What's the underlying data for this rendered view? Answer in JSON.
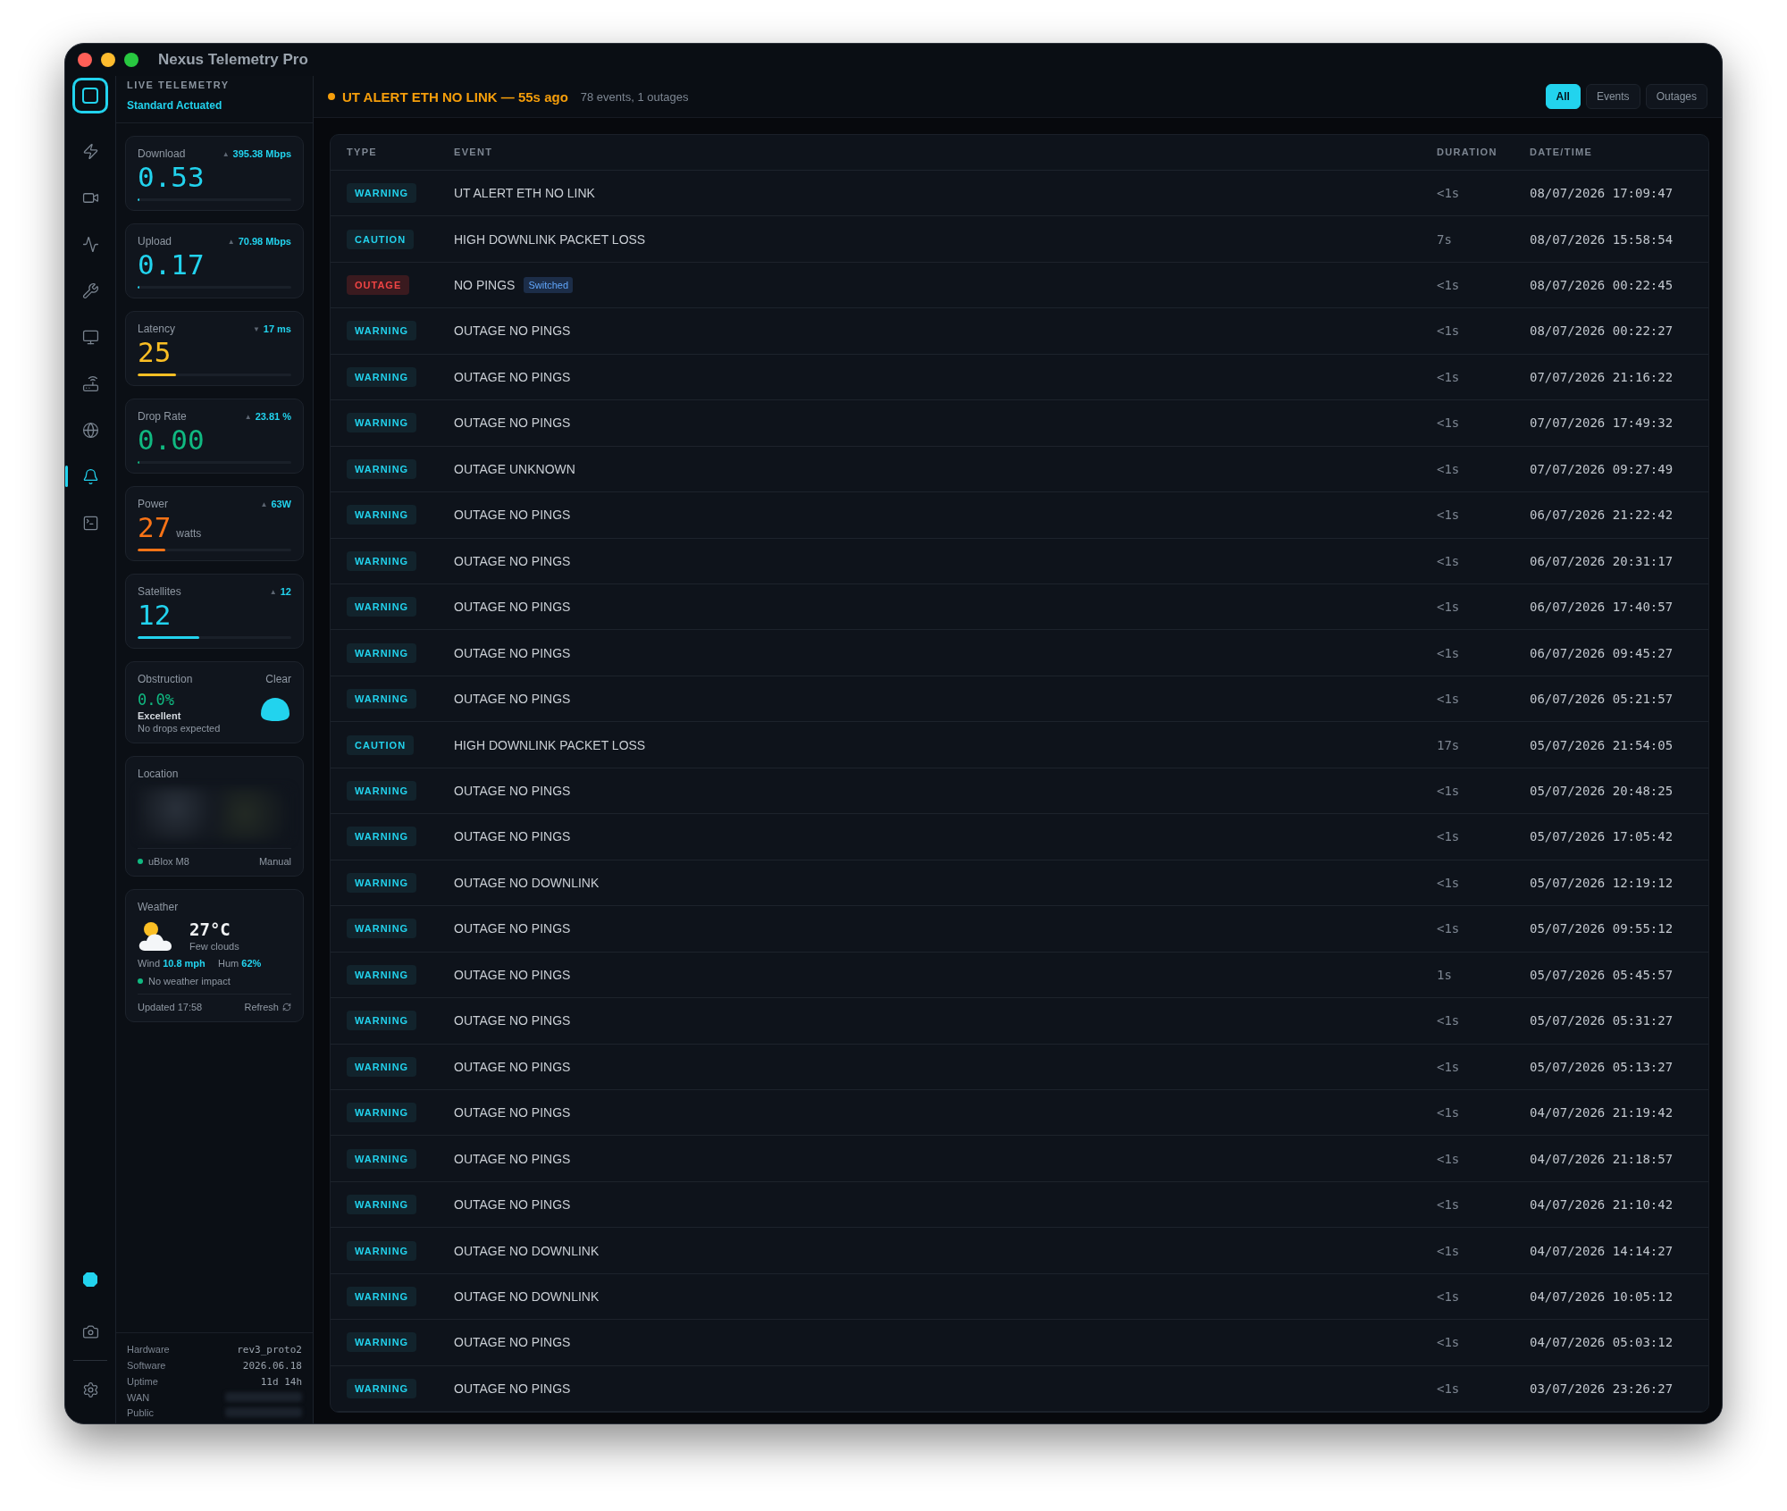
{
  "window": {
    "title": "Nexus Telemetry Pro"
  },
  "rail": {
    "items": [
      {
        "selected": false
      },
      {
        "selected": false
      },
      {
        "selected": false
      },
      {
        "selected": false
      },
      {
        "selected": false
      },
      {
        "selected": false
      },
      {
        "selected": false
      },
      {
        "selected": true
      },
      {
        "selected": false
      }
    ]
  },
  "sidebar": {
    "title": "LIVE TELEMETRY",
    "subtitle": "Standard Actuated",
    "metrics": [
      {
        "label": "Download",
        "trend": "▲",
        "delta": "395.38 Mbps",
        "value": "0.53",
        "color": "#22d3ee",
        "level": 0.01
      },
      {
        "label": "Upload",
        "trend": "▲",
        "delta": "70.98 Mbps",
        "value": "0.17",
        "color": "#22d3ee",
        "level": 0.01
      },
      {
        "label": "Latency",
        "trend": "▼",
        "delta": "17 ms",
        "value": "25",
        "color": "#fbbf24",
        "level": 0.25
      },
      {
        "label": "Drop Rate",
        "trend": "▲",
        "delta": "23.81 %",
        "value": "0.00",
        "color": "#10b981",
        "level": 0
      },
      {
        "label": "Power",
        "trend": "▲",
        "delta": "63W",
        "value": "27",
        "unit": "watts",
        "color": "#f97316",
        "level": 0.18
      },
      {
        "label": "Satellites",
        "trend": "▲",
        "delta": "12",
        "value": "12",
        "color": "#22d3ee",
        "level": 0.4
      }
    ],
    "obstruction": {
      "label": "Obstruction",
      "status": "Clear",
      "value": "0.0%",
      "rating": "Excellent",
      "note": "No drops expected"
    },
    "location": {
      "label": "Location",
      "source": "uBlox M8",
      "mode": "Manual"
    },
    "weather": {
      "label": "Weather",
      "temp": "27°C",
      "condition": "Few clouds",
      "wind_label": "Wind",
      "wind": "10.8 mph",
      "hum_label": "Hum",
      "hum": "62%",
      "impact": "No weather impact",
      "updated": "Updated 17:58",
      "refresh": "Refresh"
    },
    "system": [
      {
        "label": "Hardware",
        "value": "rev3_proto2",
        "redacted": false
      },
      {
        "label": "Software",
        "value": "2026.06.18",
        "redacted": false
      },
      {
        "label": "Uptime",
        "value": "11d 14h",
        "redacted": false
      },
      {
        "label": "WAN",
        "redacted": true
      },
      {
        "label": "Public",
        "redacted": true
      }
    ]
  },
  "header": {
    "alert": "UT ALERT ETH NO LINK — 55s ago",
    "summary": "78 events, 1 outages",
    "filters": [
      {
        "label": "All",
        "selected": true
      },
      {
        "label": "Events",
        "selected": false
      },
      {
        "label": "Outages",
        "selected": false
      }
    ]
  },
  "table": {
    "columns": [
      "TYPE",
      "EVENT",
      "DURATION",
      "DATE/TIME"
    ],
    "rows": [
      {
        "kind": "warning",
        "type": "WARNING",
        "event": "UT ALERT ETH NO LINK",
        "duration": "<1s",
        "datetime": "08/07/2026 17:09:47"
      },
      {
        "kind": "caution",
        "type": "CAUTION",
        "event": "HIGH DOWNLINK PACKET LOSS",
        "duration": "7s",
        "datetime": "08/07/2026 15:58:54"
      },
      {
        "kind": "outage",
        "type": "OUTAGE",
        "event": "NO PINGS",
        "tag": "Switched",
        "duration": "<1s",
        "datetime": "08/07/2026 00:22:45"
      },
      {
        "kind": "warning",
        "type": "WARNING",
        "event": "OUTAGE NO PINGS",
        "duration": "<1s",
        "datetime": "08/07/2026 00:22:27"
      },
      {
        "kind": "warning",
        "type": "WARNING",
        "event": "OUTAGE NO PINGS",
        "duration": "<1s",
        "datetime": "07/07/2026 21:16:22"
      },
      {
        "kind": "warning",
        "type": "WARNING",
        "event": "OUTAGE NO PINGS",
        "duration": "<1s",
        "datetime": "07/07/2026 17:49:32"
      },
      {
        "kind": "warning",
        "type": "WARNING",
        "event": "OUTAGE UNKNOWN",
        "duration": "<1s",
        "datetime": "07/07/2026 09:27:49"
      },
      {
        "kind": "warning",
        "type": "WARNING",
        "event": "OUTAGE NO PINGS",
        "duration": "<1s",
        "datetime": "06/07/2026 21:22:42"
      },
      {
        "kind": "warning",
        "type": "WARNING",
        "event": "OUTAGE NO PINGS",
        "duration": "<1s",
        "datetime": "06/07/2026 20:31:17"
      },
      {
        "kind": "warning",
        "type": "WARNING",
        "event": "OUTAGE NO PINGS",
        "duration": "<1s",
        "datetime": "06/07/2026 17:40:57"
      },
      {
        "kind": "warning",
        "type": "WARNING",
        "event": "OUTAGE NO PINGS",
        "duration": "<1s",
        "datetime": "06/07/2026 09:45:27"
      },
      {
        "kind": "warning",
        "type": "WARNING",
        "event": "OUTAGE NO PINGS",
        "duration": "<1s",
        "datetime": "06/07/2026 05:21:57"
      },
      {
        "kind": "caution",
        "type": "CAUTION",
        "event": "HIGH DOWNLINK PACKET LOSS",
        "duration": "17s",
        "datetime": "05/07/2026 21:54:05"
      },
      {
        "kind": "warning",
        "type": "WARNING",
        "event": "OUTAGE NO PINGS",
        "duration": "<1s",
        "datetime": "05/07/2026 20:48:25"
      },
      {
        "kind": "warning",
        "type": "WARNING",
        "event": "OUTAGE NO PINGS",
        "duration": "<1s",
        "datetime": "05/07/2026 17:05:42"
      },
      {
        "kind": "warning",
        "type": "WARNING",
        "event": "OUTAGE NO DOWNLINK",
        "duration": "<1s",
        "datetime": "05/07/2026 12:19:12"
      },
      {
        "kind": "warning",
        "type": "WARNING",
        "event": "OUTAGE NO PINGS",
        "duration": "<1s",
        "datetime": "05/07/2026 09:55:12"
      },
      {
        "kind": "warning",
        "type": "WARNING",
        "event": "OUTAGE NO PINGS",
        "duration": "1s",
        "datetime": "05/07/2026 05:45:57"
      },
      {
        "kind": "warning",
        "type": "WARNING",
        "event": "OUTAGE NO PINGS",
        "duration": "<1s",
        "datetime": "05/07/2026 05:31:27"
      },
      {
        "kind": "warning",
        "type": "WARNING",
        "event": "OUTAGE NO PINGS",
        "duration": "<1s",
        "datetime": "05/07/2026 05:13:27"
      },
      {
        "kind": "warning",
        "type": "WARNING",
        "event": "OUTAGE NO PINGS",
        "duration": "<1s",
        "datetime": "04/07/2026 21:19:42"
      },
      {
        "kind": "warning",
        "type": "WARNING",
        "event": "OUTAGE NO PINGS",
        "duration": "<1s",
        "datetime": "04/07/2026 21:18:57"
      },
      {
        "kind": "warning",
        "type": "WARNING",
        "event": "OUTAGE NO PINGS",
        "duration": "<1s",
        "datetime": "04/07/2026 21:10:42"
      },
      {
        "kind": "warning",
        "type": "WARNING",
        "event": "OUTAGE NO DOWNLINK",
        "duration": "<1s",
        "datetime": "04/07/2026 14:14:27"
      },
      {
        "kind": "warning",
        "type": "WARNING",
        "event": "OUTAGE NO DOWNLINK",
        "duration": "<1s",
        "datetime": "04/07/2026 10:05:12"
      },
      {
        "kind": "warning",
        "type": "WARNING",
        "event": "OUTAGE NO PINGS",
        "duration": "<1s",
        "datetime": "04/07/2026 05:03:12"
      },
      {
        "kind": "warning",
        "type": "WARNING",
        "event": "OUTAGE NO PINGS",
        "duration": "<1s",
        "datetime": "03/07/2026 23:26:27"
      }
    ]
  }
}
